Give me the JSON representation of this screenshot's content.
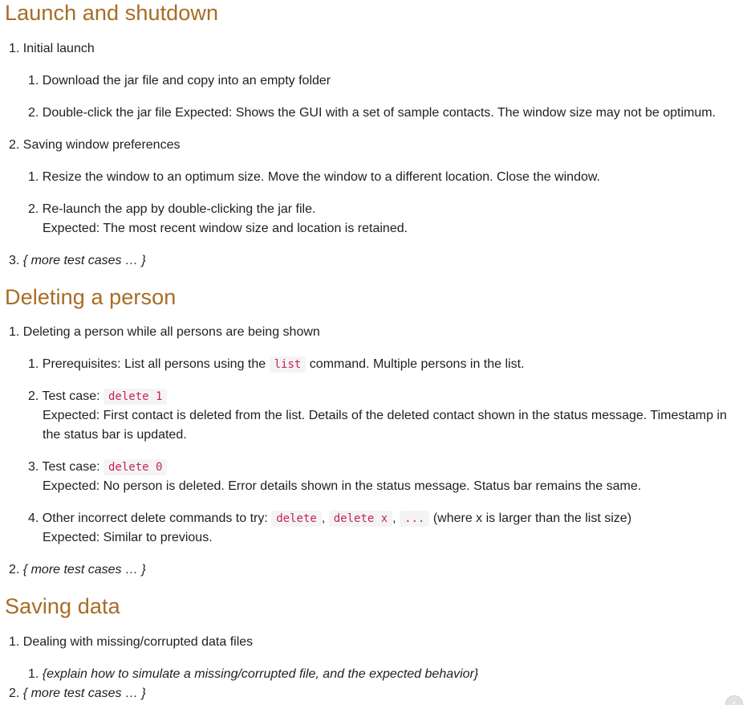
{
  "sections": [
    {
      "title": "Launch and shutdown",
      "items": [
        {
          "number": "1.",
          "label": "Initial launch",
          "subitems": [
            {
              "number": "1.",
              "text": "Download the jar file and copy into an empty folder"
            },
            {
              "number": "2.",
              "text": "Double-click the jar file Expected: Shows the GUI with a set of sample contacts. The window size may not be optimum."
            }
          ]
        },
        {
          "number": "2.",
          "label": "Saving window preferences",
          "subitems": [
            {
              "number": "1.",
              "text": "Resize the window to an optimum size. Move the window to a different location. Close the window."
            },
            {
              "number": "2.",
              "text": "Re-launch the app by double-clicking the jar file.",
              "expected": "Expected: The most recent window size and location is retained."
            }
          ]
        },
        {
          "number": "3.",
          "label": "{ more test cases … }"
        }
      ]
    },
    {
      "title": "Deleting a person",
      "items": [
        {
          "number": "1.",
          "label": "Deleting a person while all persons are being shown",
          "subitems": [
            {
              "number": "1.",
              "pre": "Prerequisites: List all persons using the",
              "code": "list",
              "post": "command. Multiple persons in the list."
            },
            {
              "number": "2.",
              "pre": "Test case:",
              "code": "delete 1",
              "expected_line1": "Expected: First contact is deleted from the list. Details of the deleted contact shown in the status message. Timestamp in",
              "expected_line2": "the status bar is updated."
            },
            {
              "number": "3.",
              "pre": "Test case:",
              "code": "delete 0",
              "expected": "Expected: No person is deleted. Error details shown in the status message. Status bar remains the same."
            },
            {
              "number": "4.",
              "pre": "Other incorrect delete commands to try:",
              "codes": [
                "delete",
                "delete x",
                "..."
              ],
              "post": "(where x is larger than the list size)",
              "expected": "Expected: Similar to previous."
            }
          ]
        },
        {
          "number": "2.",
          "label": "{ more test cases … }"
        }
      ]
    },
    {
      "title": "Saving data",
      "items": [
        {
          "number": "1.",
          "label": "Dealing with missing/corrupted data files",
          "subitems": [
            {
              "number": "1.",
              "text": "{explain how to simulate a missing/corrupted file, and the expected behavior}"
            }
          ]
        },
        {
          "number": "2.",
          "label": "{ more test cases … }"
        }
      ]
    }
  ],
  "scroll_top": {
    "icon": "arrow-up-icon",
    "glyph": "↑"
  }
}
